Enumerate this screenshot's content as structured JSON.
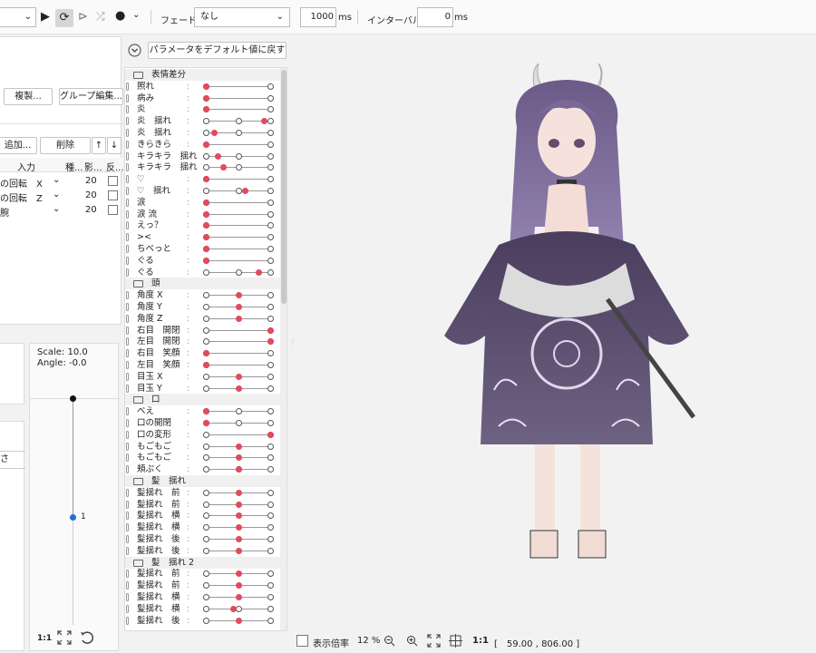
{
  "toolbar": {
    "play_label": "▶",
    "loop_label": "⟳",
    "next_label": "⊳",
    "shuffle_label": "⤮",
    "record_label": "●",
    "more_label": "⌄",
    "fade_label": "フェード：",
    "fade_value": "なし",
    "fade_ms_value": "1000",
    "interval_label": "インターバル：",
    "interval_value": "0",
    "ms_unit": "ms"
  },
  "left": {
    "duplicate_button": "複製...",
    "group_edit_button": "グループ編集...",
    "add_button": "追加...",
    "delete_button": "削除",
    "up_button": "↑",
    "down_button": "↓",
    "headers": [
      "入力",
      "種...",
      "影...",
      "反..."
    ],
    "rows": [
      {
        "input": "の回転　X",
        "type": "⌄",
        "influence": "20"
      },
      {
        "input": "の回転　Z",
        "type": "⌄",
        "influence": "20"
      },
      {
        "input": "腕",
        "type": "⌄",
        "influence": "20"
      }
    ],
    "partial_label": "さ",
    "scale_label": "Scale: 10.0",
    "angle_label": "Angle: -0.0",
    "slider_marker": "1",
    "one_to_one": "1:1"
  },
  "params": {
    "reset_button": "パラメータをデフォルト値に戻す",
    "groups": [
      {
        "title": "表情差分",
        "items": [
          {
            "label": "照れ",
            "dot": 0,
            "mid": false
          },
          {
            "label": "病み",
            "dot": 0,
            "mid": false
          },
          {
            "label": "炎",
            "dot": 0,
            "mid": false
          },
          {
            "label": "炎　揺れ",
            "dot": 0.9,
            "mid": true
          },
          {
            "label": "炎　揺れ",
            "dot": 0.12,
            "mid": true
          },
          {
            "label": "きらきら",
            "dot": 0,
            "mid": false
          },
          {
            "label": "キラキラ　揺れ",
            "dot": 0.18,
            "mid": true
          },
          {
            "label": "キラキラ　揺れ",
            "dot": 0.27,
            "mid": true
          },
          {
            "label": "♡",
            "dot": 0,
            "mid": false
          },
          {
            "label": "♡　揺れ",
            "dot": 0.6,
            "mid": true
          },
          {
            "label": "涙",
            "dot": 0,
            "mid": false
          },
          {
            "label": "涙 流",
            "dot": 0,
            "mid": false
          },
          {
            "label": "えっ？",
            "dot": 0,
            "mid": false
          },
          {
            "label": "><",
            "dot": 0,
            "mid": false
          },
          {
            "label": "ちべっと",
            "dot": 0,
            "mid": false
          },
          {
            "label": "ぐる",
            "dot": 0,
            "mid": false
          },
          {
            "label": "ぐる",
            "dot": 0.82,
            "mid": true
          }
        ]
      },
      {
        "title": "頭",
        "items": [
          {
            "label": "角度 X",
            "dot": 0.5,
            "mid": false
          },
          {
            "label": "角度 Y",
            "dot": 0.5,
            "mid": false
          },
          {
            "label": "角度 Z",
            "dot": 0.5,
            "mid": false
          },
          {
            "label": "右目　開閉",
            "dot": 1,
            "mid": false
          },
          {
            "label": "左目　開閉",
            "dot": 1,
            "mid": false
          },
          {
            "label": "右目　笑顔",
            "dot": 0,
            "mid": false
          },
          {
            "label": "左目　笑顔",
            "dot": 0,
            "mid": false
          },
          {
            "label": "目玉 X",
            "dot": 0.5,
            "mid": false
          },
          {
            "label": "目玉 Y",
            "dot": 0.5,
            "mid": false
          }
        ]
      },
      {
        "title": "口",
        "items": [
          {
            "label": "べえ",
            "dot": 0,
            "mid": true
          },
          {
            "label": "口の開閉",
            "dot": 0,
            "mid": true
          },
          {
            "label": "口の変形",
            "dot": 1,
            "mid": false
          },
          {
            "label": "もごもご",
            "dot": 0.5,
            "mid": false
          },
          {
            "label": "もごもご",
            "dot": 0.5,
            "mid": false
          },
          {
            "label": "頬ぷく",
            "dot": 0.5,
            "mid": true
          }
        ]
      },
      {
        "title": "髪　揺れ",
        "items": [
          {
            "label": "髪揺れ　前",
            "dot": 0.5,
            "mid": false
          },
          {
            "label": "髪揺れ　前",
            "dot": 0.5,
            "mid": false
          },
          {
            "label": "髪揺れ　横",
            "dot": 0.5,
            "mid": false
          },
          {
            "label": "髪揺れ　横",
            "dot": 0.5,
            "mid": false
          },
          {
            "label": "髪揺れ　後",
            "dot": 0.5,
            "mid": false
          },
          {
            "label": "髪揺れ　後",
            "dot": 0.5,
            "mid": false
          }
        ]
      },
      {
        "title": "髪　揺れ 2",
        "items": [
          {
            "label": "髪揺れ　前",
            "dot": 0.5,
            "mid": false
          },
          {
            "label": "髪揺れ　前",
            "dot": 0.5,
            "mid": false
          },
          {
            "label": "髪揺れ　横",
            "dot": 0.5,
            "mid": false
          },
          {
            "label": "髪揺れ　横",
            "dot": 0.42,
            "mid": true
          },
          {
            "label": "髪揺れ　後",
            "dot": 0.5,
            "mid": false
          }
        ]
      }
    ]
  },
  "viewer": {
    "display_scale_label": "表示倍率",
    "zoom_value": "12 %",
    "one_to_one": "1:1",
    "coords": "[　59.00 , 806.00 ]"
  },
  "colors": {
    "accent_dot": "#e24a5e",
    "slider_blue": "#1e6fd9"
  }
}
